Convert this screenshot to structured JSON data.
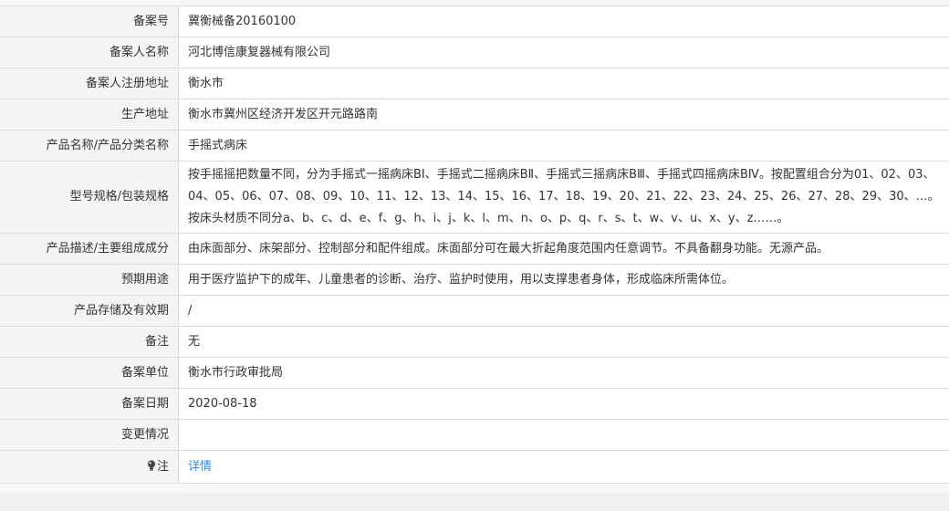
{
  "rows": [
    {
      "label": "备案号",
      "value": "冀衡械备20160100"
    },
    {
      "label": "备案人名称",
      "value": "河北博信康复器械有限公司"
    },
    {
      "label": "备案人注册地址",
      "value": "衡水市"
    },
    {
      "label": "生产地址",
      "value": "衡水市冀州区经济开发区开元路路南"
    },
    {
      "label": "产品名称/产品分类名称",
      "value": "手摇式病床"
    },
    {
      "label": "型号规格/包装规格",
      "value": "按手摇摇把数量不同，分为手摇式一摇病床BⅠ、手摇式二摇病床BⅡ、手摇式三摇病床BⅢ、手摇式四摇病床BⅣ。按配置组合分为01、02、03、04、05、06、07、08、09、10、11、12、13、14、15、16、17、18、19、20、21、22、23、24、25、26、27、28、29、30、…。按床头材质不同分a、b、c、d、e、f、g、h、i、j、k、l、m、n、o、p、q、r、s、t、w、v、u、x、y、z……。"
    },
    {
      "label": "产品描述/主要组成成分",
      "value": "由床面部分、床架部分、控制部分和配件组成。床面部分可在最大折起角度范围内任意调节。不具备翻身功能。无源产品。"
    },
    {
      "label": "预期用途",
      "value": "用于医疗监护下的成年、儿童患者的诊断、治疗、监护时使用，用以支撑患者身体，形成临床所需体位。"
    },
    {
      "label": "产品存储及有效期",
      "value": "/"
    },
    {
      "label": "备注",
      "value": "无"
    },
    {
      "label": "备案单位",
      "value": "衡水市行政审批局"
    },
    {
      "label": "备案日期",
      "value": "2020-08-18"
    },
    {
      "label": "变更情况",
      "value": ""
    }
  ],
  "note": {
    "label": "注",
    "link": "详情",
    "icon": "lightbulb-icon"
  }
}
